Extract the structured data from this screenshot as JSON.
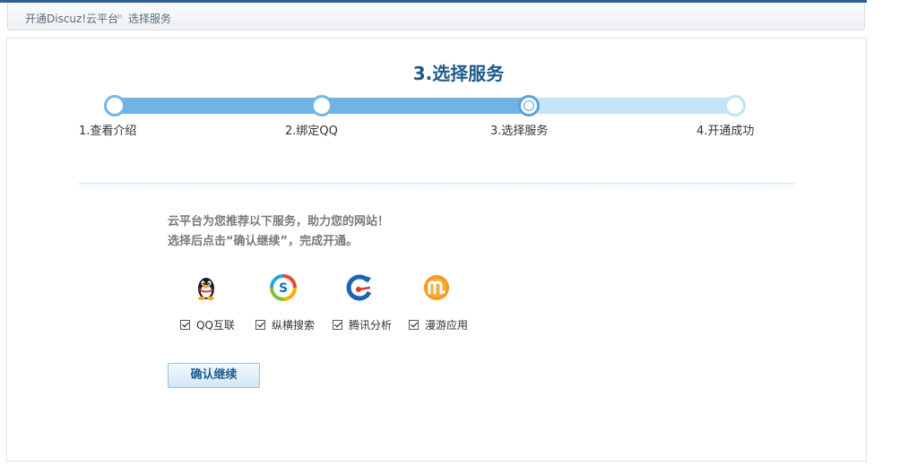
{
  "breadcrumb": {
    "root": "开通Discuz!云平台",
    "separator": "»",
    "current": "选择服务"
  },
  "page_title": "3.选择服务",
  "steps": [
    {
      "label": "1.查看介绍",
      "state": "done"
    },
    {
      "label": "2.绑定QQ",
      "state": "done"
    },
    {
      "label": "3.选择服务",
      "state": "current"
    },
    {
      "label": "4.开通成功",
      "state": "future"
    }
  ],
  "progress": 0.67,
  "intro": {
    "line1": "云平台为您推荐以下服务，助力您的网站！",
    "line2": "选择后点击“确认继续”，完成开通。"
  },
  "services": [
    {
      "name": "QQ互联",
      "icon": "qq-penguin-icon",
      "checked": true
    },
    {
      "name": "纵横搜索",
      "icon": "search-ring-icon",
      "checked": true
    },
    {
      "name": "腾讯分析",
      "icon": "analytics-gauge-icon",
      "checked": true
    },
    {
      "name": "漫游应用",
      "icon": "manyou-m-icon",
      "checked": true
    }
  ],
  "confirm_button": "确认继续",
  "colors": {
    "accent": "#1f5a8a",
    "progress_done": "#71b3e4",
    "progress_todo": "#c5e5f5"
  }
}
